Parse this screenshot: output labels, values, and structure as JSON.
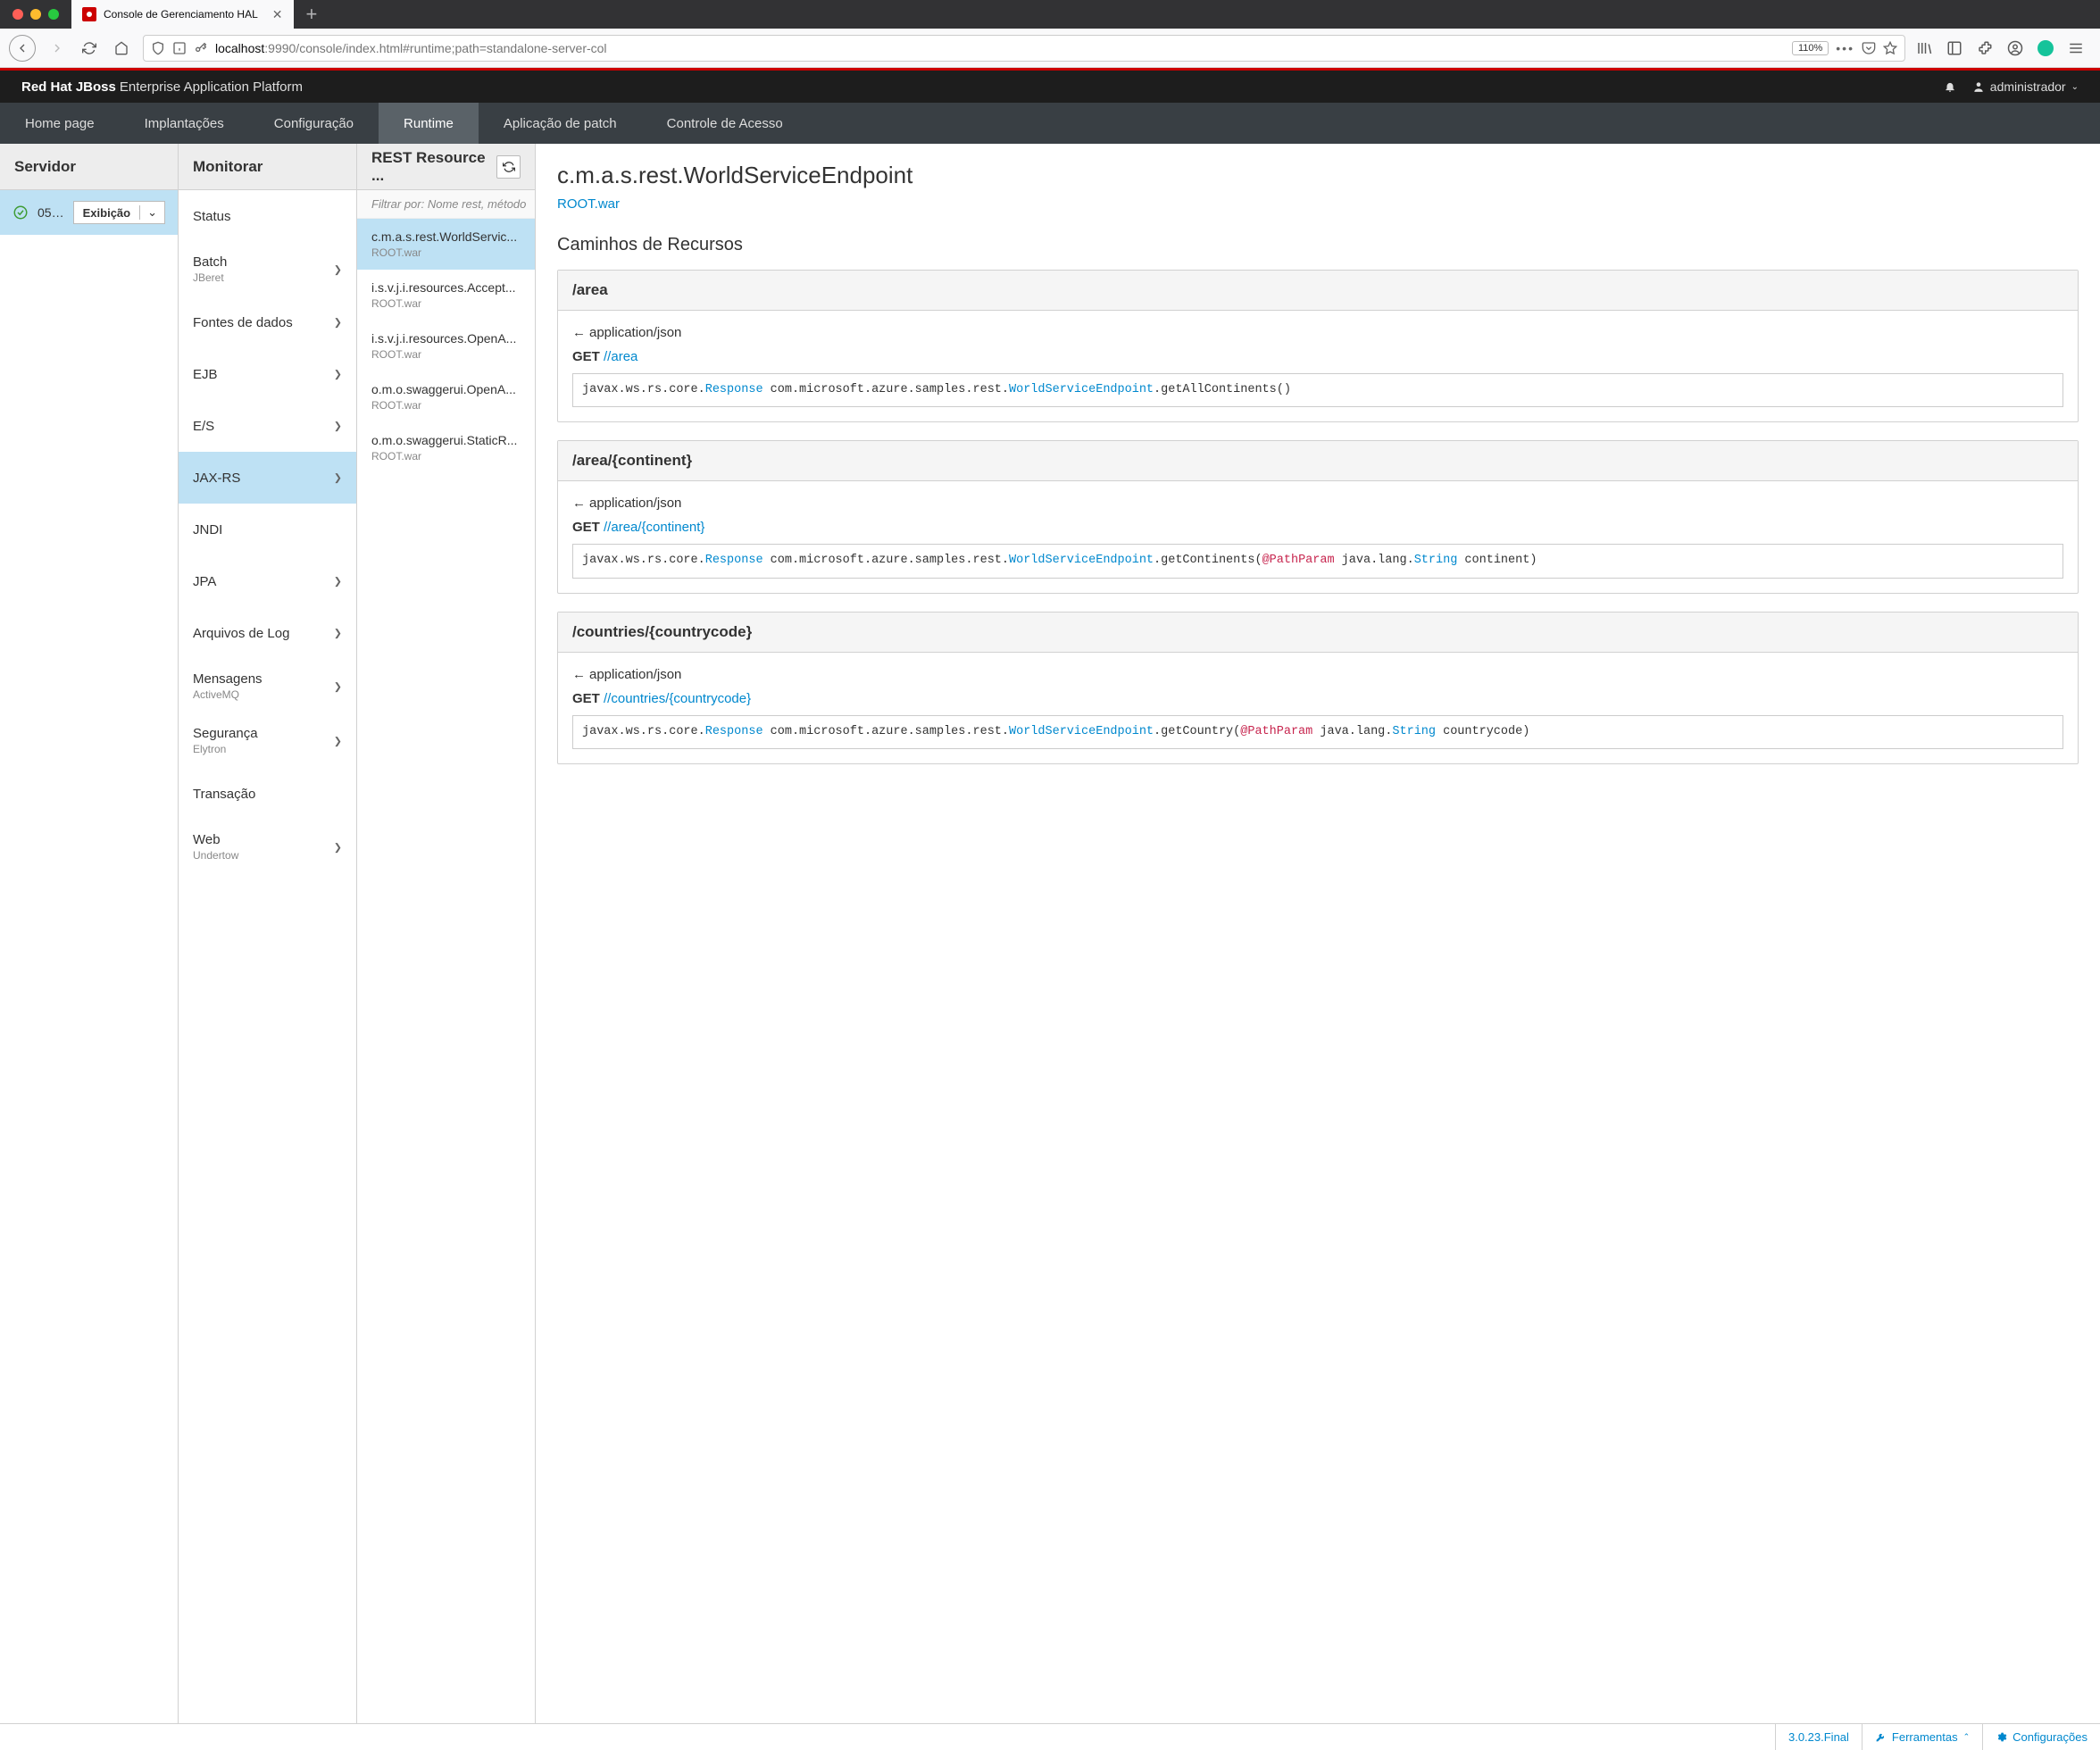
{
  "browser": {
    "tab_title": "Console de Gerenciamento HAL",
    "url_host": "localhost",
    "url_port_path": ":9990/console/index.html#runtime;path=standalone-server-col",
    "zoom": "110%"
  },
  "app": {
    "brand_strong": "Red Hat JBoss",
    "brand_rest": "Enterprise Application Platform",
    "user": "administrador"
  },
  "nav": {
    "items": [
      "Home page",
      "Implantações",
      "Configuração",
      "Runtime",
      "Aplicação de patch",
      "Controle de Acesso"
    ],
    "active": "Runtime"
  },
  "col1": {
    "header": "Servidor",
    "server_name": "05b...",
    "view_label": "Exibição"
  },
  "col2": {
    "header": "Monitorar",
    "items": [
      {
        "label": "Status",
        "has_caret": false
      },
      {
        "label": "Batch",
        "sub": "JBeret",
        "has_caret": true
      },
      {
        "label": "Fontes de dados",
        "has_caret": true
      },
      {
        "label": "EJB",
        "has_caret": true
      },
      {
        "label": "E/S",
        "has_caret": true
      },
      {
        "label": "JAX-RS",
        "has_caret": true,
        "active": true
      },
      {
        "label": "JNDI",
        "has_caret": false
      },
      {
        "label": "JPA",
        "has_caret": true
      },
      {
        "label": "Arquivos de Log",
        "has_caret": true
      },
      {
        "label": "Mensagens",
        "sub": "ActiveMQ",
        "has_caret": true
      },
      {
        "label": "Segurança",
        "sub": "Elytron",
        "has_caret": true
      },
      {
        "label": "Transação",
        "has_caret": false
      },
      {
        "label": "Web",
        "sub": "Undertow",
        "has_caret": true
      }
    ]
  },
  "col3": {
    "header": "REST Resource ...",
    "filter_placeholder": "Filtrar por: Nome rest, método",
    "items": [
      {
        "title": "c.m.a.s.rest.WorldServic...",
        "sub": "ROOT.war",
        "active": true
      },
      {
        "title": "i.s.v.j.i.resources.Accept...",
        "sub": "ROOT.war"
      },
      {
        "title": "i.s.v.j.i.resources.OpenA...",
        "sub": "ROOT.war"
      },
      {
        "title": "o.m.o.swaggerui.OpenA...",
        "sub": "ROOT.war"
      },
      {
        "title": "o.m.o.swaggerui.StaticR...",
        "sub": "ROOT.war"
      }
    ]
  },
  "detail": {
    "title": "c.m.a.s.rest.WorldServiceEndpoint",
    "deployment": "ROOT.war",
    "section": "Caminhos de Recursos",
    "resources": [
      {
        "path": "/area",
        "produces": "application/json",
        "verb": "GET",
        "link": "//area",
        "code_segments": [
          {
            "t": "javax.ws.rs.core."
          },
          {
            "t": "Response",
            "c": "tok-type"
          },
          {
            "t": " com.microsoft.azure.samples.rest."
          },
          {
            "t": "WorldServiceEndpoint",
            "c": "tok-type"
          },
          {
            "t": ".getAllContinents()"
          }
        ]
      },
      {
        "path": "/area/{continent}",
        "produces": "application/json",
        "verb": "GET",
        "link": "//area/{continent}",
        "code_segments": [
          {
            "t": "javax.ws.rs.core."
          },
          {
            "t": "Response",
            "c": "tok-type"
          },
          {
            "t": " com.microsoft.azure.samples.rest."
          },
          {
            "t": "WorldServiceEndpoint",
            "c": "tok-type"
          },
          {
            "t": ".getContinents("
          },
          {
            "t": "@PathParam",
            "c": "tok-ann"
          },
          {
            "t": " java.lang."
          },
          {
            "t": "String",
            "c": "tok-type"
          },
          {
            "t": " continent)"
          }
        ]
      },
      {
        "path": "/countries/{countrycode}",
        "produces": "application/json",
        "verb": "GET",
        "link": "//countries/{countrycode}",
        "code_segments": [
          {
            "t": "javax.ws.rs.core."
          },
          {
            "t": "Response",
            "c": "tok-type"
          },
          {
            "t": " com.microsoft.azure.samples.rest."
          },
          {
            "t": "WorldServiceEndpoint",
            "c": "tok-type"
          },
          {
            "t": ".getCountry("
          },
          {
            "t": "@PathParam",
            "c": "tok-ann"
          },
          {
            "t": " java.lang."
          },
          {
            "t": "String",
            "c": "tok-type"
          },
          {
            "t": " countrycode)"
          }
        ]
      }
    ]
  },
  "footer": {
    "version": "3.0.23.Final",
    "tools": "Ferramentas",
    "config": "Configurações"
  }
}
